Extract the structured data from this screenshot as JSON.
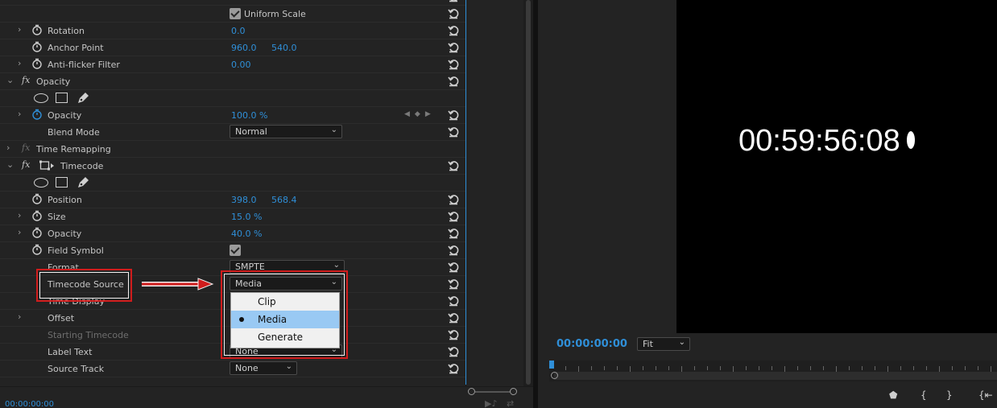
{
  "effects": {
    "uniform_scale_label": "Uniform Scale",
    "rows": {
      "rotation": {
        "label": "Rotation",
        "value": "0.0"
      },
      "anchor": {
        "label": "Anchor Point",
        "x": "960.0",
        "y": "540.0"
      },
      "antiflicker": {
        "label": "Anti-flicker Filter",
        "value": "0.00"
      },
      "opacity_group": {
        "label": "Opacity",
        "fx": "fx"
      },
      "opacity": {
        "label": "Opacity",
        "value": "100.0 %"
      },
      "blend": {
        "label": "Blend Mode",
        "value": "Normal"
      },
      "time_remap": {
        "label": "Time Remapping",
        "fx": "fx"
      },
      "timecode_group": {
        "label": "Timecode",
        "fx": "fx"
      },
      "position": {
        "label": "Position",
        "x": "398.0",
        "y": "568.4"
      },
      "size": {
        "label": "Size",
        "value": "15.0 %"
      },
      "tc_opacity": {
        "label": "Opacity",
        "value": "40.0 %"
      },
      "field_symbol": {
        "label": "Field Symbol"
      },
      "format": {
        "label": "Format",
        "value": "SMPTE"
      },
      "timecode_source": {
        "label": "Timecode Source",
        "value": "Media"
      },
      "time_display": {
        "label": "Time Display"
      },
      "offset": {
        "label": "Offset"
      },
      "starting_tc": {
        "label": "Starting Timecode"
      },
      "label_text": {
        "label": "Label Text",
        "value": "None"
      },
      "source_track": {
        "label": "Source Track",
        "value": "None"
      }
    },
    "bottom_timecode": "00:00:00:00"
  },
  "popup": {
    "options": [
      "Clip",
      "Media",
      "Generate"
    ],
    "selected": "Media"
  },
  "monitor": {
    "overlay_timecode": "00:59:56:08",
    "playhead_timecode": "00:00:00:00",
    "zoom": "Fit"
  },
  "colors": {
    "accent_blue": "#2f8fd8",
    "annotation_red": "#d01c1c",
    "panel_bg": "#232323"
  }
}
